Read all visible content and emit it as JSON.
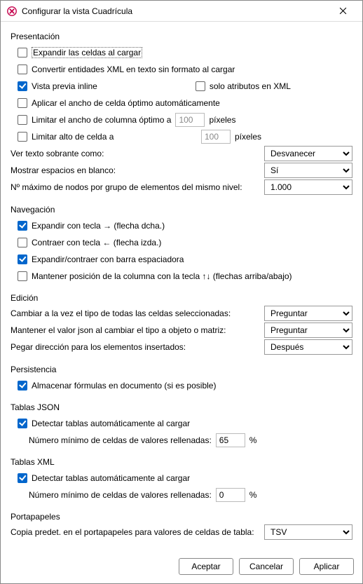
{
  "title": "Configurar la vista Cuadrícula",
  "groups": {
    "presentation": "Presentación",
    "navigation": "Navegación",
    "edition": "Edición",
    "persistence": "Persistencia",
    "jsonTables": "Tablas JSON",
    "xmlTables": "Tablas XML",
    "clipboard": "Portapapeles"
  },
  "presentation": {
    "expandCells": "Expandir las celdas al cargar",
    "convertEntities": "Convertir entidades XML en texto sin formato al cargar",
    "inlinePreview": "Vista previa inline",
    "onlyAttributes": "solo atributos en XML",
    "applyOptimalWidth": "Aplicar el ancho de celda óptimo automáticamente",
    "limitColWidth": "Limitar el ancho de columna óptimo a",
    "limitColWidthValue": "100",
    "pxUnit": "píxeles",
    "limitRowHeight": "Limitar alto de celda a",
    "limitRowHeightValue": "100",
    "overflowLabel": "Ver texto sobrante como:",
    "overflowValue": "Desvanecer",
    "whitespaceLabel": "Mostrar espacios en blanco:",
    "whitespaceValue": "Sí",
    "maxNodesLabel": "Nº máximo de nodos por grupo de elementos del mismo nivel:",
    "maxNodesValue": "1.000"
  },
  "navigation": {
    "expandRight": "Expandir con tecla → (flecha dcha.)",
    "collapseLeft": "Contraer con tecla ← (flecha izda.)",
    "spacebar": "Expandir/contraer con barra espaciadora",
    "keepColPos": "Mantener posición de la columna con la tecla ↑↓ (flechas arriba/abajo)"
  },
  "edition": {
    "changeTypeLabel": "Cambiar a la vez el tipo de todas las celdas seleccionadas:",
    "changeTypeValue": "Preguntar",
    "keepJsonLabel": "Mantener el valor json al cambiar el tipo a objeto o matriz:",
    "keepJsonValue": "Preguntar",
    "pasteDirLabel": "Pegar dirección para los elementos insertados:",
    "pasteDirValue": "Después"
  },
  "persistence": {
    "storeFormulas": "Almacenar fórmulas en documento (si es posible)"
  },
  "jsonTables": {
    "detect": "Detectar tablas automáticamente al cargar",
    "minCellsLabel": "Número mínimo de celdas de valores rellenadas:",
    "minCellsValue": "65",
    "percent": "%"
  },
  "xmlTables": {
    "detect": "Detectar tablas automáticamente al cargar",
    "minCellsLabel": "Número mínimo de celdas de valores rellenadas:",
    "minCellsValue": "0",
    "percent": "%"
  },
  "clipboard": {
    "defaultCopyLabel": "Copia predet. en el portapapeles para valores de celdas de tabla:",
    "defaultCopyValue": "TSV"
  },
  "buttons": {
    "ok": "Aceptar",
    "cancel": "Cancelar",
    "apply": "Aplicar"
  }
}
